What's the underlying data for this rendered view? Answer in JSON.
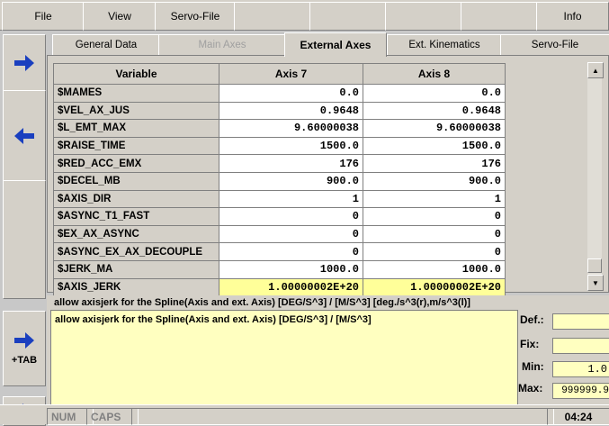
{
  "menu": {
    "file": "File",
    "view": "View",
    "servo_file": "Servo-File",
    "info": "Info"
  },
  "tabs": [
    {
      "label": "General Data",
      "state": "normal"
    },
    {
      "label": "Main Axes",
      "state": "disabled"
    },
    {
      "label": "External Axes",
      "state": "active"
    },
    {
      "label": "Ext. Kinematics",
      "state": "normal"
    },
    {
      "label": "Servo-File",
      "state": "normal"
    }
  ],
  "table": {
    "headers": [
      "Variable",
      "Axis 7",
      "Axis 8"
    ],
    "rows": [
      {
        "name": "$MAMES",
        "a7": "0.0",
        "a8": "0.0"
      },
      {
        "name": "$VEL_AX_JUS",
        "a7": "0.9648",
        "a8": "0.9648"
      },
      {
        "name": "$L_EMT_MAX",
        "a7": "9.60000038",
        "a8": "9.60000038"
      },
      {
        "name": "$RAISE_TIME",
        "a7": "1500.0",
        "a8": "1500.0"
      },
      {
        "name": "$RED_ACC_EMX",
        "a7": "176",
        "a8": "176"
      },
      {
        "name": "$DECEL_MB",
        "a7": "900.0",
        "a8": "900.0"
      },
      {
        "name": "$AXIS_DIR",
        "a7": "1",
        "a8": "1"
      },
      {
        "name": "$ASYNC_T1_FAST",
        "a7": "0",
        "a8": "0"
      },
      {
        "name": "$EX_AX_ASYNC",
        "a7": "0",
        "a8": "0"
      },
      {
        "name": "$ASYNC_EX_AX_DECOUPLE",
        "a7": "0",
        "a8": "0"
      },
      {
        "name": "$JERK_MA",
        "a7": "1000.0",
        "a8": "1000.0"
      },
      {
        "name": "$AXIS_JERK",
        "a7": "1.00000002E+20",
        "a8": "1.00000002E+20",
        "selected": true
      }
    ]
  },
  "description": {
    "title": "allow axisjerk for the Spline(Axis and ext. Axis) [DEG/S^3] / [M/S^3]      [deg./s^3(r),m/s^3(l)]",
    "text": "allow axisjerk for the Spline(Axis and ext. Axis) [DEG/S^3] / [M/S^3]",
    "def_label": "Def.:",
    "def_value": "",
    "fix_label": "Fix:",
    "fix_value": "",
    "min_label": "Min:",
    "min_value": "1.0",
    "max_label": "Max:",
    "max_value": "999999.9"
  },
  "side": {
    "tab_label": "+TAB"
  },
  "status": {
    "num": "NUM",
    "caps": "CAPS",
    "time": "04:24"
  },
  "colors": {
    "arrow": "#1a3fbf",
    "selected_row": "#ffff99",
    "desc_bg": "#ffffc0"
  }
}
